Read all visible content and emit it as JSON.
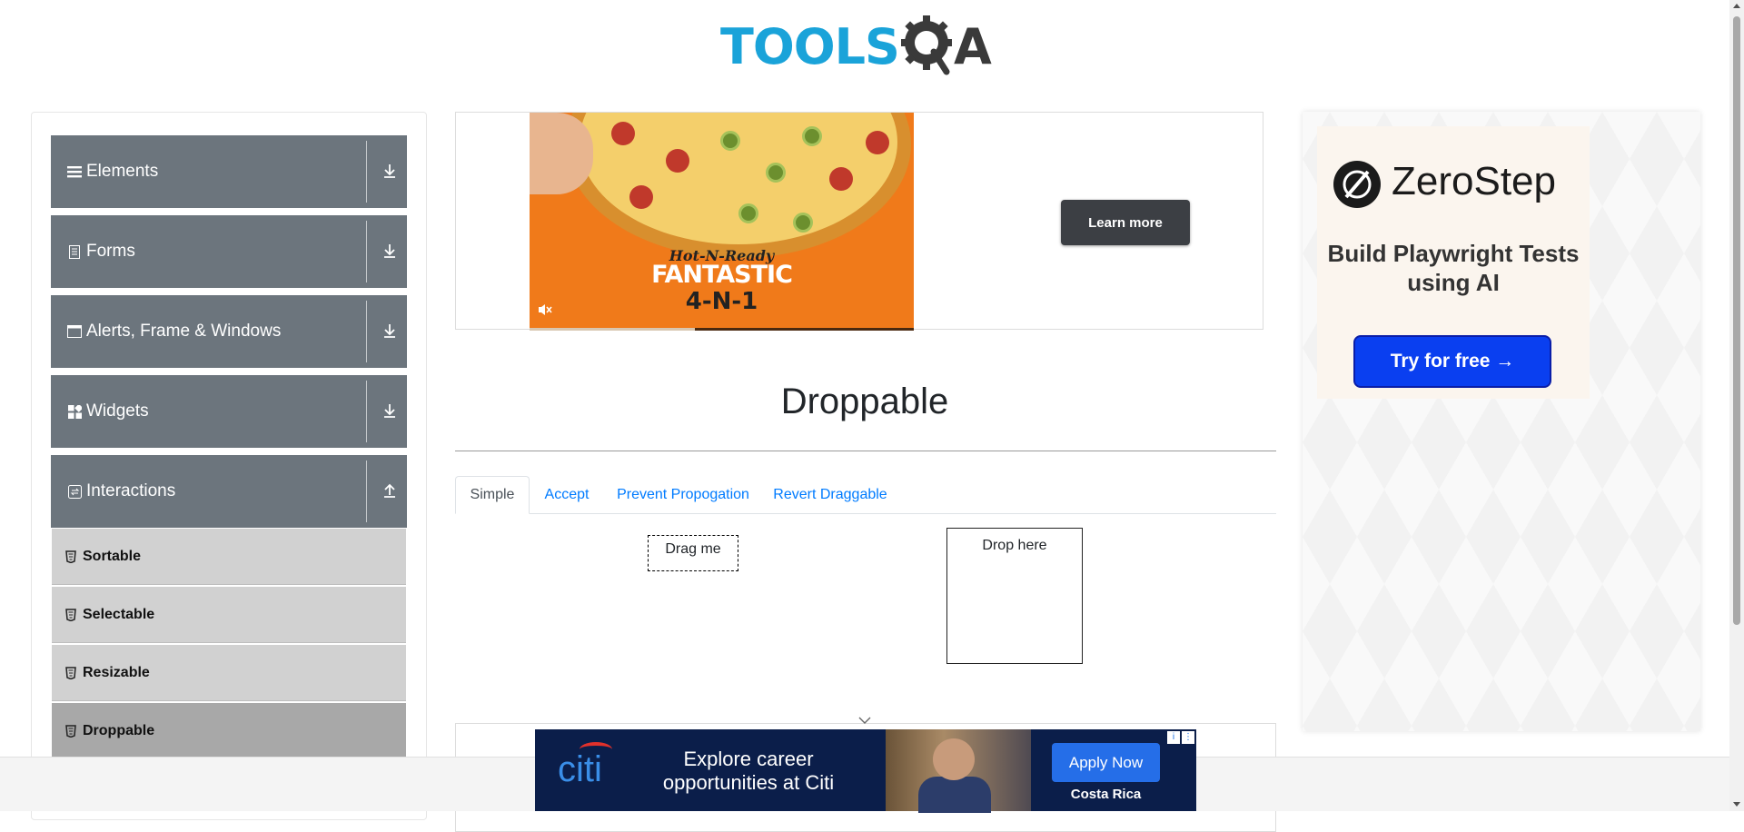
{
  "header": {
    "logo_main": "TOOLS",
    "logo_qa": "A"
  },
  "sidebar": {
    "groups": [
      {
        "label": "Elements",
        "icon": "hamburger-icon",
        "expanded": false
      },
      {
        "label": "Forms",
        "icon": "document-icon",
        "expanded": false
      },
      {
        "label": "Alerts, Frame & Windows",
        "icon": "window-icon",
        "expanded": false
      },
      {
        "label": "Widgets",
        "icon": "widgets-icon",
        "expanded": false
      },
      {
        "label": "Interactions",
        "icon": "interactions-icon",
        "expanded": true
      }
    ],
    "items": [
      {
        "label": "Sortable",
        "active": false
      },
      {
        "label": "Selectable",
        "active": false
      },
      {
        "label": "Resizable",
        "active": false
      },
      {
        "label": "Droppable",
        "active": true
      }
    ]
  },
  "top_ad": {
    "tagline_script": "Hot-N-Ready",
    "headline": "FANTASTIC",
    "subline": "4-N-1",
    "cta": "Learn more",
    "progress": 0.43
  },
  "main": {
    "title": "Droppable",
    "tabs": [
      "Simple",
      "Accept",
      "Prevent Propogation",
      "Revert Draggable"
    ],
    "active_tab": "Simple",
    "drag_label": "Drag me",
    "drop_label": "Drop here"
  },
  "right_ad": {
    "brand": "ZeroStep",
    "tagline": "Build Playwright Tests using AI",
    "cta": "Try for free →"
  },
  "bottom_ad": {
    "brand": "citi",
    "text": "Explore career opportunities at Citi",
    "cta": "Apply Now",
    "location": "Costa Rica",
    "info_glyph": "i",
    "close_glyph": "⋮"
  },
  "colors": {
    "accent_blue": "#007bff",
    "sidebar_group": "#6c757d",
    "sidebar_item": "#d1d1d1",
    "logo_blue": "#1aa3d9"
  }
}
